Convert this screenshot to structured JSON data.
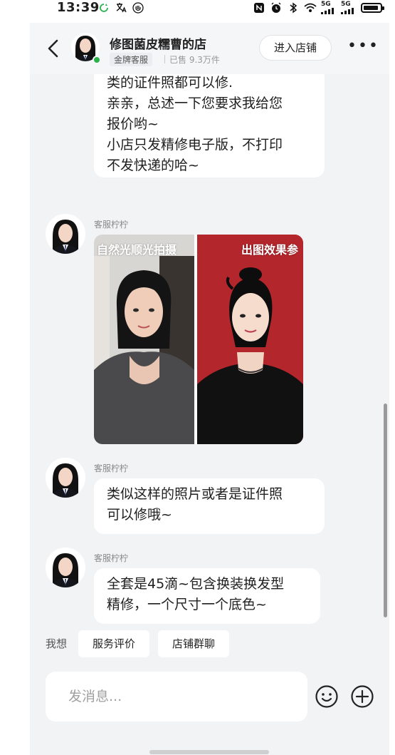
{
  "status_bar": {
    "time": "13:39",
    "signal_1": "5G",
    "signal_2": "5G"
  },
  "header": {
    "shop_name": "修图菌皮糯曹的店",
    "badge": "金牌客服",
    "sales": "已售 9.3万件",
    "enter_shop": "进入店铺",
    "more": "•••"
  },
  "messages": {
    "first": {
      "lines": [
        "类的证件照都可以修.",
        "亲亲，总述一下您要求我给您",
        "报价哟~",
        "小店只发精修电子版，不打印",
        "不发快递的哈~"
      ]
    },
    "image_msg": {
      "sender": "客服柠柠",
      "left_caption": "自然光顺光拍摄",
      "right_caption": "出图效果参"
    },
    "second": {
      "sender": "客服柠柠",
      "lines": [
        "类似这样的照片或者是证件照",
        "可以修哦~"
      ]
    },
    "third": {
      "sender": "客服柠柠",
      "lines": [
        "全套是45滴~包含换装换发型",
        "精修，一个尺寸一个底色~"
      ]
    }
  },
  "quick_bar": {
    "label": "我想",
    "chips": [
      "服务评价",
      "店铺群聊"
    ]
  },
  "input": {
    "placeholder": "发消息..."
  },
  "colors": {
    "page_bg": "#f2f3f5",
    "bubble_bg": "#ffffff",
    "online_dot": "#2bb24c",
    "right_photo_bg": "#b3262c"
  },
  "icons": {
    "back": "chevron-left-icon",
    "more": "more-dots-icon",
    "emoji": "emoji-icon",
    "plus": "plus-icon"
  }
}
